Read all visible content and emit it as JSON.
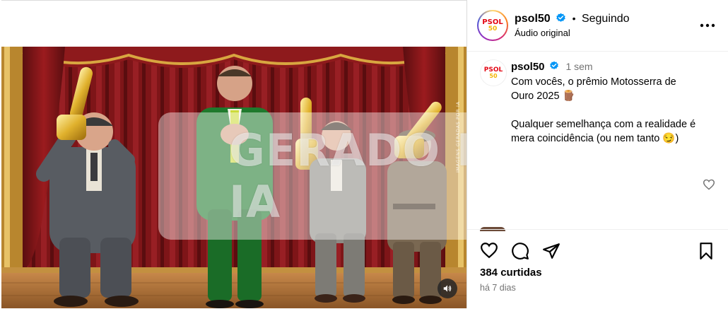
{
  "post": {
    "media": {
      "watermark_text": "GERADO POR IA",
      "side_label": "IMAGENS GERADAS POR IA",
      "sound_icon": "speaker-icon"
    },
    "header": {
      "username": "psol50",
      "separator": "•",
      "follow_status": "Seguindo",
      "subtitle": "Áudio original",
      "avatar_logo_top": "PSOL",
      "avatar_logo_bottom": "50",
      "more_icon": "more-options-icon"
    },
    "caption": {
      "username": "psol50",
      "time": "1 sem",
      "line1": "Com vocês, o prêmio Motosserra de",
      "line2": "Ouro 2025 🪵",
      "line3": "Qualquer semelhança com a realidade é",
      "line4": "mera coincidência (ou nem tanto 😏)",
      "like_icon": "heart-outline-icon"
    },
    "actions": {
      "like_icon": "heart-icon",
      "comment_icon": "comment-icon",
      "share_icon": "share-icon",
      "save_icon": "bookmark-icon",
      "likes": "384 curtidas",
      "date": "há 7 dias"
    },
    "colors": {
      "verified": "#0095f6",
      "brand_red": "#e30613",
      "muted": "#737373"
    }
  }
}
